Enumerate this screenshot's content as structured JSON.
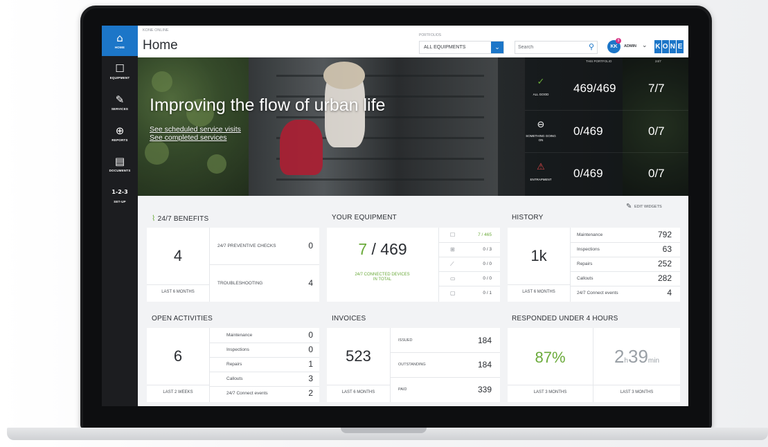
{
  "app": {
    "product": "KONE ONLINE",
    "page_title": "Home"
  },
  "nav": [
    {
      "label": "HOME",
      "icon": "home-icon",
      "glyph": "⌂"
    },
    {
      "label": "EQUIPMENT",
      "icon": "equipment-icon",
      "glyph": "☐"
    },
    {
      "label": "SERVICES",
      "icon": "wrench-icon",
      "glyph": "✎"
    },
    {
      "label": "REPORTS",
      "icon": "report-icon",
      "glyph": "⊕"
    },
    {
      "label": "DOCUMENTS",
      "icon": "document-icon",
      "glyph": "▤"
    },
    {
      "label": "SET-UP",
      "icon": "setup-icon",
      "glyph": "1-2-3"
    }
  ],
  "header": {
    "portfolios_label": "PORTFOLIOS",
    "portfolio_value": "ALL EQUIPMENTS",
    "search_placeholder": "Search",
    "avatar_initials": "KK",
    "avatar_badge": "9",
    "user_role": "ADMIN",
    "brand_letters": [
      "K",
      "O",
      "N",
      "E"
    ]
  },
  "hero": {
    "title": "Improving the flow of urban life",
    "links": [
      "See scheduled service visits",
      "See completed services"
    ],
    "col_this_portfolio": "THIS PORTFOLIO",
    "col_247": "24/7",
    "rows": [
      {
        "icon": "check-circle-icon",
        "glyph": "✓",
        "label": "ALL GOOD",
        "portfolio": "469/469",
        "connected": "7/7",
        "color": "#6aaa3a"
      },
      {
        "icon": "minus-circle-icon",
        "glyph": "⊖",
        "label": "SOMETHING GOING ON",
        "portfolio": "0/469",
        "connected": "0/7",
        "color": "#ffffff"
      },
      {
        "icon": "warning-icon",
        "glyph": "⚠",
        "label": "ENTRAPMENT",
        "portfolio": "0/469",
        "connected": "0/7",
        "color": "#d64545"
      }
    ]
  },
  "edit_widgets": "EDIT WIDGETS",
  "benefits": {
    "title": "24/7 BENEFITS",
    "big": "4",
    "caption": "LAST 6 MONTHS",
    "rows": [
      {
        "label": "24/7 PREVENTIVE CHECKS",
        "value": "0"
      },
      {
        "label": "TROUBLESHOOTING",
        "value": "4"
      }
    ]
  },
  "equipment": {
    "title": "YOUR EQUIPMENT",
    "big_connected": "7",
    "big_total": " / 469",
    "caption": "24/7 CONNECTED DEVICES IN TOTAL",
    "rows": [
      {
        "icon": "elevator-icon",
        "glyph": "☐",
        "value": "7 / 465"
      },
      {
        "icon": "door-icon",
        "glyph": "⊞",
        "value": "0 / 3"
      },
      {
        "icon": "escalator-icon",
        "glyph": "⟋",
        "value": "0 / 0"
      },
      {
        "icon": "walkway-icon",
        "glyph": "▭",
        "value": "0 / 0"
      },
      {
        "icon": "other-icon",
        "glyph": "▢",
        "value": "0 / 1"
      }
    ]
  },
  "history": {
    "title": "HISTORY",
    "big": "1k",
    "caption": "LAST 6 MONTHS",
    "rows": [
      {
        "label": "Maintenance",
        "value": "792"
      },
      {
        "label": "Inspections",
        "value": "63"
      },
      {
        "label": "Repairs",
        "value": "252"
      },
      {
        "label": "Callouts",
        "value": "282"
      },
      {
        "label": "24/7 Connect events",
        "value": "4"
      }
    ]
  },
  "open_activities": {
    "title": "OPEN ACTIVITIES",
    "big": "6",
    "caption": "LAST 2 WEEKS",
    "rows": [
      {
        "label": "Maintenance",
        "value": "0"
      },
      {
        "label": "Inspections",
        "value": "0"
      },
      {
        "label": "Repairs",
        "value": "1"
      },
      {
        "label": "Callouts",
        "value": "3"
      },
      {
        "label": "24/7 Connect events",
        "value": "2"
      }
    ]
  },
  "invoices": {
    "title": "INVOICES",
    "big": "523",
    "caption": "LAST 6 MONTHS",
    "rows": [
      {
        "label": "ISSUED",
        "value": "184"
      },
      {
        "label": "OUTSTANDING",
        "value": "184"
      },
      {
        "label": "PAID",
        "value": "339"
      }
    ]
  },
  "responded": {
    "title": "RESPONDED UNDER 4 HOURS",
    "percent": "87%",
    "hours": "2",
    "hours_unit": "h",
    "minutes": "39",
    "minutes_unit": "min",
    "caption_left": "LAST 3 MONTHS",
    "caption_right": "LAST 3 MONTHS"
  },
  "colors": {
    "accent": "#1c76c8",
    "positive": "#6aaa3a",
    "alert": "#d64545"
  }
}
